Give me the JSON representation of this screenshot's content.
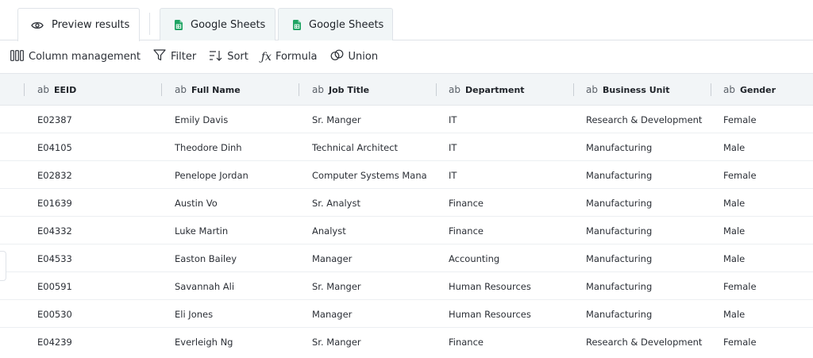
{
  "tabs": [
    {
      "label": "Preview results",
      "icon": "eye-icon",
      "active": true
    },
    {
      "label": "Google Sheets",
      "icon": "google-sheets-icon",
      "active": false
    },
    {
      "label": "Google Sheets",
      "icon": "google-sheets-icon",
      "active": false
    }
  ],
  "toolbar": {
    "column_management": "Column management",
    "filter": "Filter",
    "sort": "Sort",
    "formula": "Formula",
    "union": "Union",
    "fx_glyph": "ƒx"
  },
  "columns": [
    {
      "type": "ab",
      "label": "EEID"
    },
    {
      "type": "ab",
      "label": "Full Name"
    },
    {
      "type": "ab",
      "label": "Job Title"
    },
    {
      "type": "ab",
      "label": "Department"
    },
    {
      "type": "ab",
      "label": "Business Unit"
    },
    {
      "type": "ab",
      "label": "Gender"
    }
  ],
  "rows": [
    [
      "E02387",
      "Emily Davis",
      "Sr. Manger",
      "IT",
      "Research & Development",
      "Female"
    ],
    [
      "E04105",
      "Theodore Dinh",
      "Technical Architect",
      "IT",
      "Manufacturing",
      "Male"
    ],
    [
      "E02832",
      "Penelope Jordan",
      "Computer Systems Mana...",
      "IT",
      "Manufacturing",
      "Female"
    ],
    [
      "E01639",
      "Austin Vo",
      "Sr. Analyst",
      "Finance",
      "Manufacturing",
      "Male"
    ],
    [
      "E04332",
      "Luke Martin",
      "Analyst",
      "Finance",
      "Manufacturing",
      "Male"
    ],
    [
      "E04533",
      "Easton Bailey",
      "Manager",
      "Accounting",
      "Manufacturing",
      "Male"
    ],
    [
      "E00591",
      "Savannah Ali",
      "Sr. Manger",
      "Human Resources",
      "Manufacturing",
      "Female"
    ],
    [
      "E00530",
      "Eli Jones",
      "Manager",
      "Human Resources",
      "Manufacturing",
      "Male"
    ],
    [
      "E04239",
      "Everleigh Ng",
      "Sr. Manger",
      "Finance",
      "Research & Development",
      "Female"
    ]
  ],
  "colors": {
    "sheets_green": "#1fa463",
    "header_bg": "#f2f5f7",
    "inactive_tab_bg": "#f1f6f7"
  }
}
